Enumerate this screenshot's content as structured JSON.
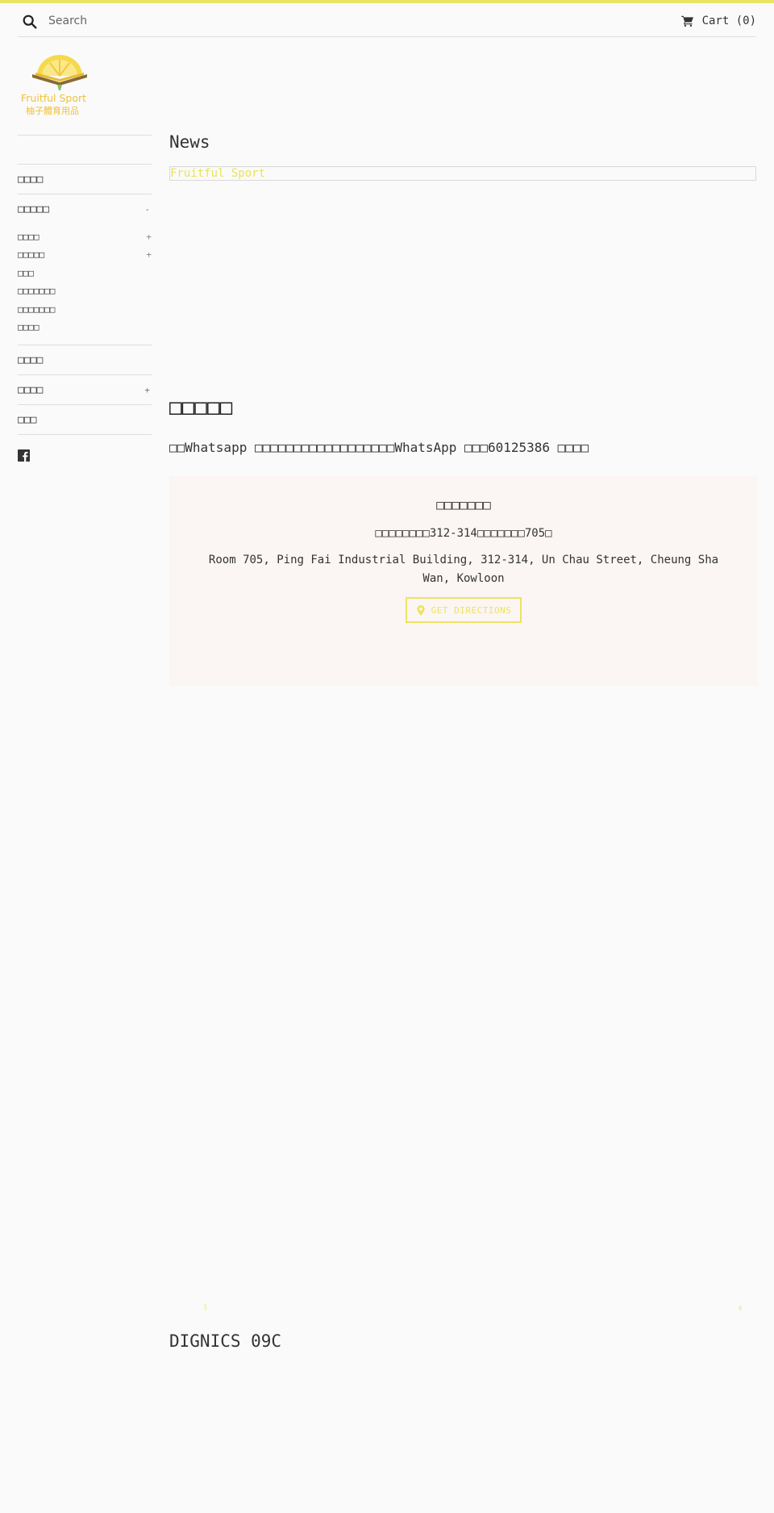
{
  "colors": {
    "accent": "#ebe462",
    "text": "#333333",
    "background": "#fafafa",
    "map_bg": "#fbf5f4",
    "divider": "#dedede"
  },
  "header": {
    "search": {
      "placeholder": "Search",
      "value": "",
      "icon": "search-icon"
    },
    "cart": {
      "label": "Cart (0)",
      "icon": "cart-icon"
    }
  },
  "logo": {
    "line1": "Fruitful Sport",
    "line2": "柚子體育用品"
  },
  "sidebar": {
    "items": [
      {
        "label": "□□□□",
        "toggle": ""
      },
      {
        "label": "□□□□□",
        "toggle": "-",
        "children": [
          {
            "label": "□□□□",
            "toggle": "+"
          },
          {
            "label": "□□□□□",
            "toggle": "+"
          },
          {
            "label": "□□□",
            "toggle": ""
          },
          {
            "label": "□□□□□□□",
            "toggle": ""
          },
          {
            "label": "□□□□□□□",
            "toggle": ""
          },
          {
            "label": "□□□□",
            "toggle": ""
          }
        ]
      },
      {
        "label": "□□□□",
        "toggle": ""
      },
      {
        "label": "□□□□",
        "toggle": "+"
      },
      {
        "label": "□□□",
        "toggle": ""
      }
    ],
    "social": {
      "icon": "facebook-icon"
    }
  },
  "main": {
    "news_title": "News",
    "news_frame_text": "Fruitful Sport",
    "contact_title": "□□□□□",
    "contact_desc": "□□Whatsapp □□□□□□□□□□□□□□□□□□WhatsApp □□□60125386 □□□□",
    "map": {
      "title": "□□□□□□□",
      "address_zh": "□□□□□□□□312-314□□□□□□□705□",
      "address_en": "Room 705, Ping Fai Industrial Building, 312-314, Un Chau Street, Cheung Sha Wan, Kowloon",
      "directions_label": "GET DIRECTIONS",
      "directions_icon": "map-pin-icon"
    },
    "slider": {
      "prev_glyph": "ᛝ",
      "next_glyph": "॥"
    },
    "product_title": "DIGNICS 09C"
  }
}
